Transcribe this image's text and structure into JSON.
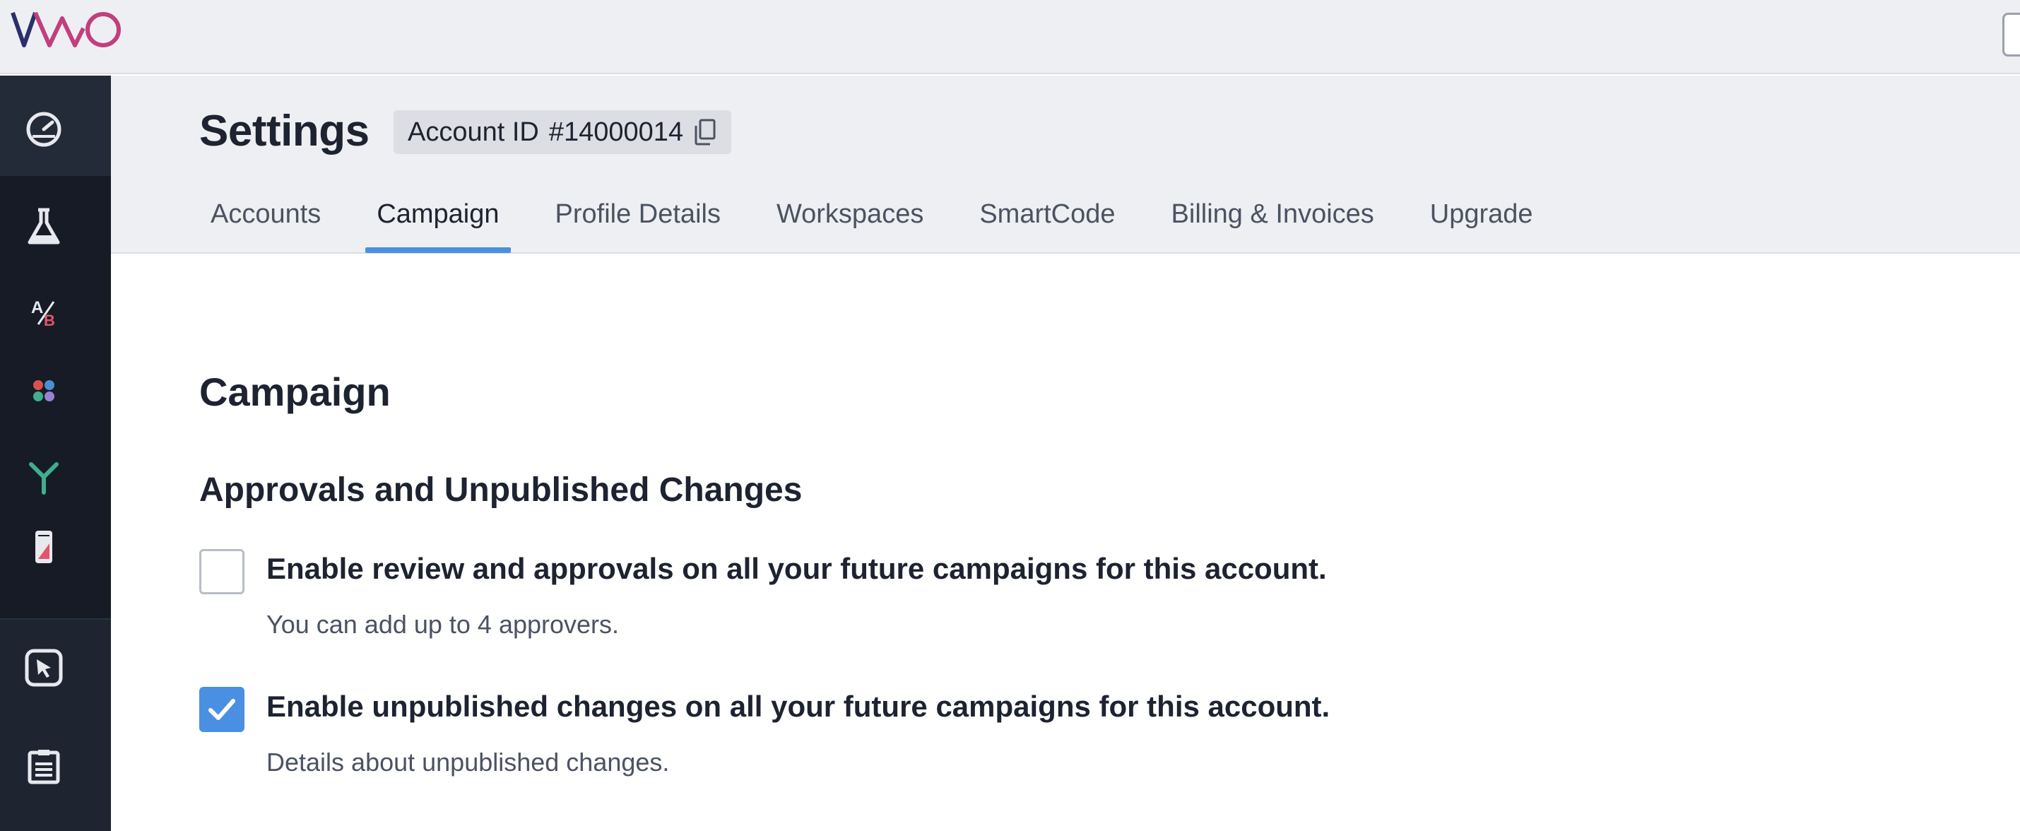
{
  "app": {
    "logo_text": "VWO"
  },
  "sidebar": {
    "items": [
      {
        "icon": "dashboard-gauge-icon",
        "active": true
      },
      {
        "icon": "flask-icon"
      },
      {
        "icon": "ab-test-icon"
      },
      {
        "icon": "dots-grid-icon"
      },
      {
        "icon": "split-url-icon"
      },
      {
        "icon": "mobile-app-icon"
      },
      {
        "icon": "cursor-select-icon"
      },
      {
        "icon": "clipboard-list-icon"
      }
    ]
  },
  "header": {
    "title": "Settings",
    "account_label": "Account ID",
    "account_id": "#14000014"
  },
  "tabs": [
    {
      "label": "Accounts"
    },
    {
      "label": "Campaign",
      "active": true
    },
    {
      "label": "Profile Details"
    },
    {
      "label": "Workspaces"
    },
    {
      "label": "SmartCode"
    },
    {
      "label": "Billing & Invoices"
    },
    {
      "label": "Upgrade"
    }
  ],
  "main": {
    "section_title": "Campaign",
    "sub_title": "Approvals and Unpublished Changes",
    "options": [
      {
        "label": "Enable review and approvals on all your future campaigns for this account.",
        "help": "You can add up to 4 approvers.",
        "checked": false
      },
      {
        "label": "Enable unpublished changes on all your future campaigns for this account.",
        "help": "Details about unpublished changes.",
        "checked": true
      }
    ]
  },
  "colors": {
    "accent": "#4a90e2",
    "sidebar_bg": "#161b25",
    "header_bg": "#eeeff2",
    "logo_dark": "#2b2f6b",
    "logo_pink": "#c13f7d"
  }
}
